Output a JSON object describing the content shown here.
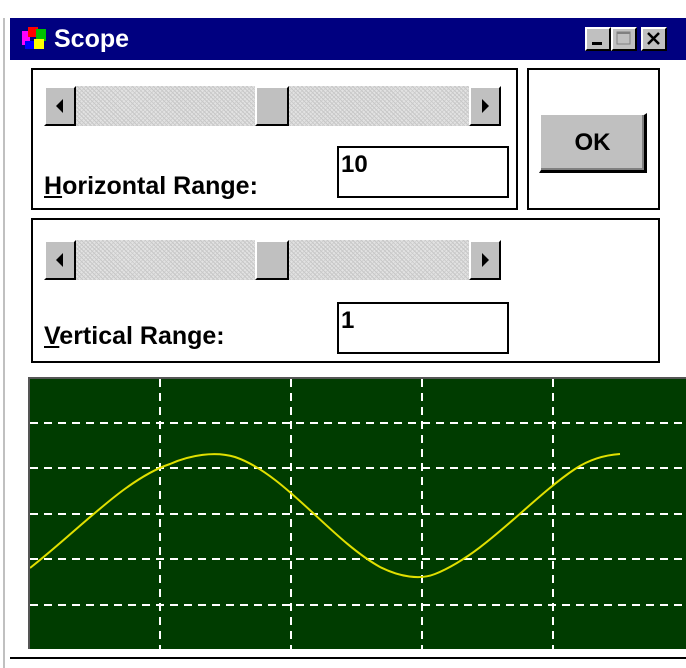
{
  "window": {
    "title": "Scope",
    "icon": "scope-app-icon",
    "controls": [
      "minimize-icon",
      "maximize-icon",
      "close-icon"
    ]
  },
  "horizontal": {
    "label_accel": "H",
    "label_rest": "orizontal Range:",
    "value": "10",
    "scroll_position": 0.52
  },
  "vertical": {
    "label_accel": "V",
    "label_rest": "ertical Range:",
    "value": "1",
    "scroll_position": 0.52
  },
  "ok_button": {
    "label": "OK"
  },
  "scope_display": {
    "background": "#003c00",
    "grid_color": "#ffffff",
    "trace_color": "#e0e000",
    "grid_columns": 5,
    "grid_rows": 6
  }
}
